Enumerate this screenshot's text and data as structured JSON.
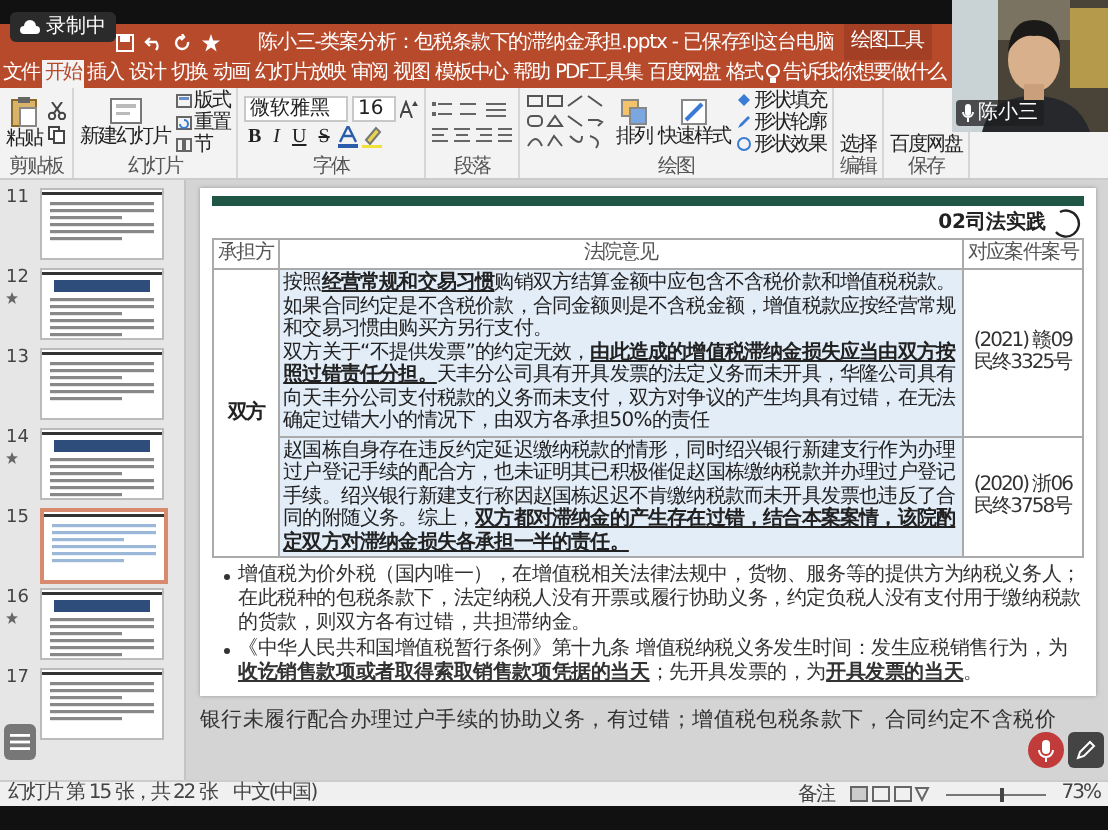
{
  "recording_badge": {
    "label": "录制中"
  },
  "window": {
    "title": "陈小三-类案分析：包税条款下的滞纳金承担.pptx  -  已保存到这台电脑",
    "context_tab": "绘图工具"
  },
  "tabs": [
    {
      "label": "文件",
      "selected": false
    },
    {
      "label": "开始",
      "selected": true
    },
    {
      "label": "插入",
      "selected": false
    },
    {
      "label": "设计",
      "selected": false
    },
    {
      "label": "切换",
      "selected": false
    },
    {
      "label": "动画",
      "selected": false
    },
    {
      "label": "幻灯片放映",
      "selected": false
    },
    {
      "label": "审阅",
      "selected": false
    },
    {
      "label": "视图",
      "selected": false
    },
    {
      "label": "模板中心",
      "selected": false
    },
    {
      "label": "帮助",
      "selected": false
    },
    {
      "label": "PDF工具集",
      "selected": false
    },
    {
      "label": "百度网盘",
      "selected": false
    },
    {
      "label": "格式",
      "selected": false
    }
  ],
  "tell_me": {
    "placeholder": "告诉我你想要做什么"
  },
  "ribbon": {
    "clipboard": {
      "label": "剪贴板",
      "paste": "粘贴"
    },
    "slides": {
      "label": "幻灯片",
      "new_slide": "新建幻灯片",
      "layout": "版式",
      "reset": "重置",
      "section": "节"
    },
    "font": {
      "label": "字体",
      "family": "微软雅黑",
      "size": "16",
      "buttons": [
        "B",
        "I",
        "U",
        "S"
      ]
    },
    "paragraph": {
      "label": "段落"
    },
    "drawing": {
      "label": "绘图",
      "arrange": "排列",
      "quick_styles": "快速样式",
      "fill": "形状填充",
      "outline": "形状轮廓",
      "effects": "形状效果"
    },
    "editing": {
      "label": "编辑",
      "select": "选择"
    },
    "save": {
      "label": "保存",
      "baidu": "百度网盘"
    }
  },
  "video": {
    "kind": "picture",
    "name": "陈小三"
  },
  "thumbnails": [
    {
      "number": "11",
      "starred": false,
      "selected": false
    },
    {
      "number": "12",
      "starred": true,
      "selected": false
    },
    {
      "number": "13",
      "starred": false,
      "selected": false
    },
    {
      "number": "14",
      "starred": true,
      "selected": false
    },
    {
      "number": "15",
      "starred": false,
      "selected": true
    },
    {
      "number": "16",
      "starred": true,
      "selected": false
    },
    {
      "number": "17",
      "starred": false,
      "selected": false
    }
  ],
  "slide": {
    "section_title": "02司法实践",
    "table": {
      "columns": [
        "承担方",
        "法院意见",
        "对应案件案号"
      ],
      "rows": [
        {
          "party": "双方",
          "opinions": [
            {
              "paragraphs": [
                "按照**经营常规和交易习惯**购销双方结算金额中应包含不含税价款和增值税税款。如果合同约定是不含税价款，合同金额则是不含税金额，增值税款应按经营常规和交易习惯由购买方另行支付。",
                "双方关于“不提供发票”的约定无效，**由此造成的增值税滞纳金损失应当由双方按照过错责任分担。**天丰分公司具有开具发票的法定义务而未开具，华隆公司具有向天丰分公司支付税款的义务而未支付，双方对争议的产生均具有过错，在无法确定过错大小的情况下，由双方各承担50%的责任"
              ],
              "case": "(2021) 赣09民终3325号"
            },
            {
              "paragraphs": [
                "赵国栋自身存在违反约定延迟缴纳税款的情形，同时绍兴银行新建支行作为办理过户登记手续的配合方，也未证明其已积极催促赵国栋缴纳税款并办理过户登记手续。绍兴银行新建支行称因赵国栋迟迟不肯缴纳税款而未开具发票也违反了合同的附随义务。综上，**双方都对滞纳金的产生存在过错，结合本案案情，该院酌定双方对滞纳金损失各承担一半的责任。**"
              ],
              "case": "(2020) 浙06民终3758号"
            }
          ]
        }
      ]
    },
    "bullets": [
      "增值税为价外税（国内唯一），在增值税相关法律法规中，货物、服务等的提供方为纳税义务人；在此税种的包税条款下，法定纳税人没有开票或履行协助义务，约定负税人没有支付用于缴纳税款的货款，则双方各有过错，共担滞纳金。",
      "《中华人民共和国增值税暂行条例》第十九条 增值税纳税义务发生时间：发生应税销售行为，为**收讫销售款项或者取得索取销售款项凭据的当天**；先开具发票的，为**开具发票的当天**。"
    ]
  },
  "subtitle": "银行未履行配合办理过户手续的协助义务，有过错；增值税包税条款下，合同约定不含税价",
  "status_bar": {
    "slide_info": "幻灯片 第 15 张，共 22 张",
    "language": "中文(中国)",
    "notes": "备注",
    "zoom": {
      "level": 0.55,
      "reading": "73%"
    }
  }
}
